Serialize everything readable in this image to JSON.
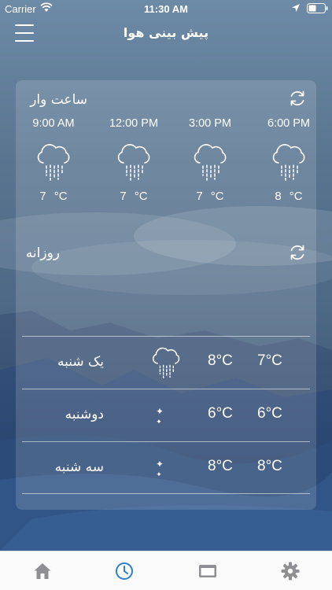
{
  "status_bar": {
    "carrier": "Carrier",
    "time": "11:30 AM"
  },
  "header": {
    "title": "پیش بینی هوا"
  },
  "hourly": {
    "title": "ساعت وار",
    "items": [
      {
        "time": "9:00 AM",
        "temp": "7",
        "unit": "°C",
        "icon": "rain-cloud-icon"
      },
      {
        "time": "12:00 PM",
        "temp": "7",
        "unit": "°C",
        "icon": "rain-cloud-icon"
      },
      {
        "time": "3:00 PM",
        "temp": "7",
        "unit": "°C",
        "icon": "rain-cloud-icon"
      },
      {
        "time": "6:00 PM",
        "temp": "8",
        "unit": "°C",
        "icon": "rain-cloud-icon"
      }
    ]
  },
  "daily": {
    "title": "روزانه",
    "rows": [
      {
        "day": "یک شنبه",
        "icon": "rain-cloud-icon",
        "max": "8°C",
        "min": "7°C"
      },
      {
        "day": "دوشنبه",
        "icon": "night-moon-icon",
        "max": "6°C",
        "min": "6°C"
      },
      {
        "day": "سه شنبه",
        "icon": "night-moon-icon",
        "max": "8°C",
        "min": "8°C"
      }
    ]
  },
  "tab_bar": {
    "tabs": [
      {
        "icon": "home-icon",
        "active": false
      },
      {
        "icon": "clock-icon",
        "active": true
      },
      {
        "icon": "screen-icon",
        "active": false
      },
      {
        "icon": "gear-icon",
        "active": false
      }
    ],
    "active_color": "#2f7fd0",
    "inactive_color": "#8e8e93"
  }
}
